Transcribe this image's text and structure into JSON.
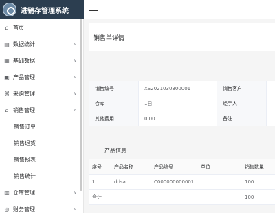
{
  "app": {
    "brand_title": "进销存管理系统"
  },
  "sidebar": {
    "items": [
      {
        "icon": "home-icon",
        "glyph": "⌂",
        "label": "首页",
        "expandable": false
      },
      {
        "icon": "chart-icon",
        "glyph": "▤",
        "label": "数据统计",
        "expandable": true
      },
      {
        "icon": "grid-icon",
        "glyph": "▦",
        "label": "基础数据",
        "expandable": true
      },
      {
        "icon": "box-icon",
        "glyph": "▣",
        "label": "产品管理",
        "expandable": true
      },
      {
        "icon": "cart-icon",
        "glyph": "⌘",
        "label": "采购管理",
        "expandable": true
      },
      {
        "icon": "tag-icon",
        "glyph": "⌂",
        "label": "销售管理",
        "expandable": true,
        "open": true
      }
    ],
    "sub_items": [
      "销售订单",
      "销售退货",
      "销售报表",
      "销售统计"
    ],
    "bottom_items": [
      {
        "icon": "warehouse-icon",
        "glyph": "▥",
        "label": "仓库管理",
        "expandable": true
      },
      {
        "icon": "finance-icon",
        "glyph": "◎",
        "label": "财务管理",
        "expandable": true
      }
    ]
  },
  "main": {
    "page_title": "销售单详情",
    "detail": {
      "rows": [
        {
          "label1": "销售编号",
          "value1": "XS2021030300001",
          "label2": "销售客户",
          "value2": ""
        },
        {
          "label1": "仓库",
          "value1": "1日",
          "label2": "经手人",
          "value2": ""
        },
        {
          "label1": "其他费用",
          "value1": "0.00",
          "label2": "备注",
          "value2": ""
        }
      ]
    },
    "products_title": "产品信息",
    "products": {
      "columns": [
        "序号",
        "产品名称",
        "产品编号",
        "单位",
        "销售数量"
      ],
      "rows": [
        [
          "1",
          "ddsa",
          "C000000000001",
          "",
          "100"
        ]
      ],
      "total": [
        "合计",
        "",
        "",
        "",
        "100"
      ]
    }
  }
}
